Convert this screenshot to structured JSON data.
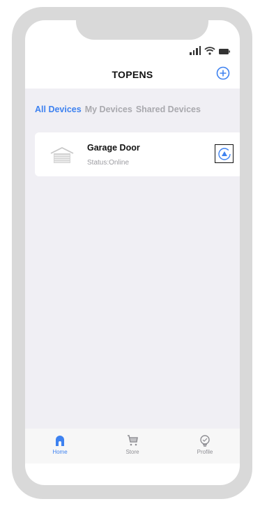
{
  "header": {
    "title": "TOPENS"
  },
  "tabs": [
    {
      "label": "All Devices",
      "active": true
    },
    {
      "label": "My Devices",
      "active": false
    },
    {
      "label": "Shared Devices",
      "active": false
    }
  ],
  "device": {
    "name": "Garage Door",
    "status": "Status:Online",
    "icon": "garage-door-icon",
    "action_icon": "open-arrow-icon"
  },
  "tabbar": [
    {
      "label": "Home",
      "icon": "home-icon",
      "active": true
    },
    {
      "label": "Store",
      "icon": "cart-icon",
      "active": false
    },
    {
      "label": "Profile",
      "icon": "lightbulb-icon",
      "active": false
    }
  ],
  "colors": {
    "accent": "#3e82f0",
    "background": "#f0eff4",
    "inactive_text": "#a9a9ae"
  }
}
